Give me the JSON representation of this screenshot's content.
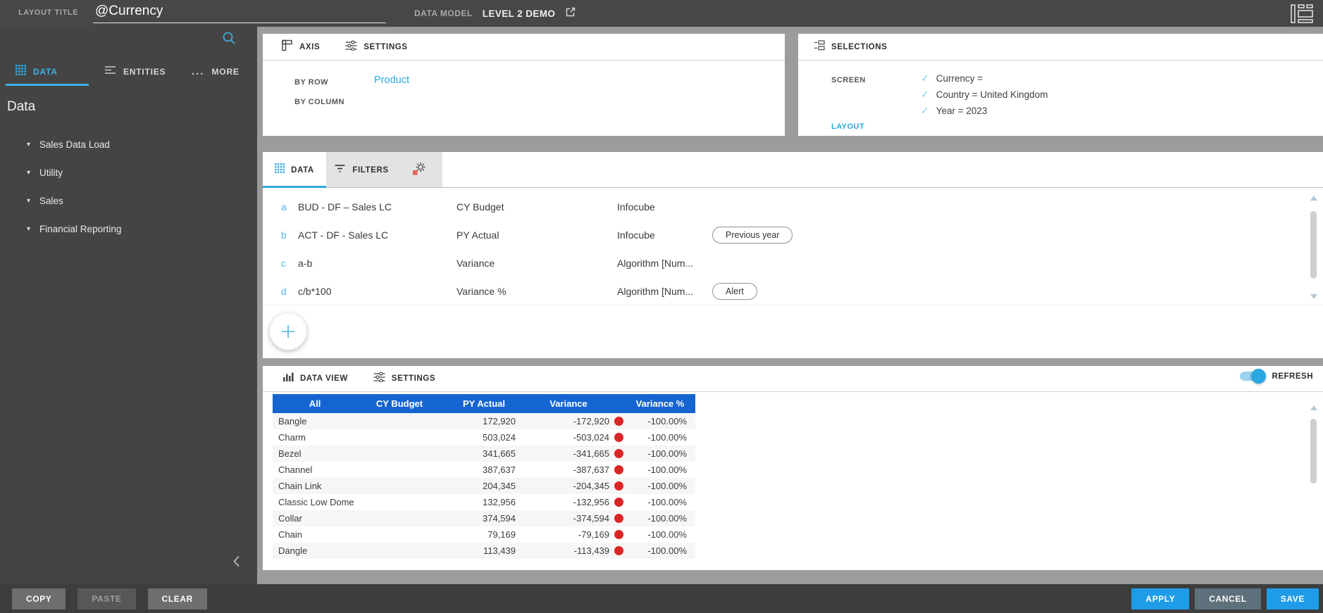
{
  "topbar": {
    "layout_title_label": "LAYOUT TITLE",
    "layout_title_value": "@Currency",
    "data_model_label": "DATA MODEL",
    "data_model_value": "LEVEL 2 DEMO"
  },
  "sidebar": {
    "tabs": [
      {
        "label": "DATA"
      },
      {
        "label": "ENTITIES"
      },
      {
        "label": "MORE"
      }
    ],
    "heading": "Data",
    "tree": [
      {
        "label": "Sales Data Load"
      },
      {
        "label": "Utility"
      },
      {
        "label": "Sales"
      },
      {
        "label": "Financial Reporting"
      }
    ]
  },
  "axis_panel": {
    "tab_axis": "AXIS",
    "tab_settings": "SETTINGS",
    "by_row_label": "BY ROW",
    "by_row_value": "Product",
    "by_column_label": "BY COLUMN",
    "by_column_value": ""
  },
  "selections_panel": {
    "title": "SELECTIONS",
    "screen_label": "SCREEN",
    "layout_label": "LAYOUT",
    "items": [
      {
        "text": "Currency ="
      },
      {
        "text": "Country = United Kingdom"
      },
      {
        "text": "Year = 2023"
      }
    ]
  },
  "data_panel": {
    "tab_data": "DATA",
    "tab_filters": "FILTERS",
    "rows": [
      {
        "letter": "a",
        "formula": "BUD - DF – Sales LC",
        "name": "CY Budget",
        "type": "Infocube",
        "tag": ""
      },
      {
        "letter": "b",
        "formula": "ACT - DF - Sales LC",
        "name": "PY Actual",
        "type": "Infocube",
        "tag": "Previous year"
      },
      {
        "letter": "c",
        "formula": "a-b",
        "name": "Variance",
        "type": "Algorithm [Num...",
        "tag": ""
      },
      {
        "letter": "d",
        "formula": "c/b*100",
        "name": "Variance %",
        "type": "Algorithm [Num...",
        "tag": "Alert"
      }
    ]
  },
  "dataview_panel": {
    "tab_data_view": "DATA VIEW",
    "tab_settings": "SETTINGS",
    "refresh_label": "REFRESH",
    "refresh_on": true,
    "table": {
      "columns": [
        "All",
        "CY Budget",
        "PY Actual",
        "Variance",
        "Variance %"
      ],
      "rows": [
        {
          "product": "Bangle",
          "cy_budget": "",
          "py_actual": "172,920",
          "variance": "-172,920",
          "variance_pct": "-100.00%"
        },
        {
          "product": "Charm",
          "cy_budget": "",
          "py_actual": "503,024",
          "variance": "-503,024",
          "variance_pct": "-100.00%"
        },
        {
          "product": "Bezel",
          "cy_budget": "",
          "py_actual": "341,665",
          "variance": "-341,665",
          "variance_pct": "-100.00%"
        },
        {
          "product": "Channel",
          "cy_budget": "",
          "py_actual": "387,637",
          "variance": "-387,637",
          "variance_pct": "-100.00%"
        },
        {
          "product": "Chain Link",
          "cy_budget": "",
          "py_actual": "204,345",
          "variance": "-204,345",
          "variance_pct": "-100.00%"
        },
        {
          "product": "Classic Low Dome",
          "cy_budget": "",
          "py_actual": "132,956",
          "variance": "-132,956",
          "variance_pct": "-100.00%"
        },
        {
          "product": "Collar",
          "cy_budget": "",
          "py_actual": "374,594",
          "variance": "-374,594",
          "variance_pct": "-100.00%"
        },
        {
          "product": "Chain",
          "cy_budget": "",
          "py_actual": "79,169",
          "variance": "-79,169",
          "variance_pct": "-100.00%"
        },
        {
          "product": "Dangle",
          "cy_budget": "",
          "py_actual": "113,439",
          "variance": "-113,439",
          "variance_pct": "-100.00%"
        }
      ]
    }
  },
  "footer": {
    "copy": "COPY",
    "paste": "PASTE",
    "clear": "CLEAR",
    "apply": "APPLY",
    "cancel": "CANCEL",
    "save": "SAVE"
  },
  "colors": {
    "accent_cyan": "#2fa9e0",
    "table_header_blue": "#1565d0",
    "alert_red": "#d92626",
    "primary_button_blue": "#1e9ce8",
    "cancel_button_gray": "#5e707b"
  }
}
